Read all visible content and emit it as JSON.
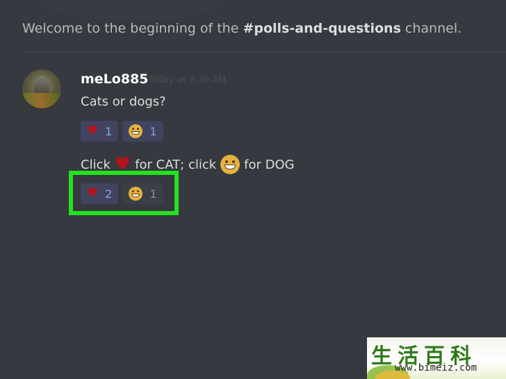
{
  "channel": {
    "welcome_prefix": "Welcome to the beginning of the ",
    "name": "#polls-and-questions",
    "welcome_suffix": " channel."
  },
  "message": {
    "username": "meLo885",
    "timestamp": "Today at 9:30 AM",
    "line1": "Cats or dogs?",
    "reactions1": [
      {
        "icon": "heart-icon",
        "count": "1"
      },
      {
        "icon": "grinning-face-icon",
        "count": "1"
      }
    ],
    "line2_part1": "Click",
    "line2_part2": "for CAT; click",
    "line2_part3": "for DOG",
    "reactions2": [
      {
        "icon": "heart-icon",
        "count": "2"
      },
      {
        "icon": "grinning-face-icon",
        "count": "1"
      }
    ]
  },
  "watermark": {
    "chars": "生活百科",
    "url": "www.bimeiz.com"
  },
  "colors": {
    "background": "#36393f",
    "highlight": "#22e31f",
    "heart": "#b5121b",
    "reaction_active_count": "#8ea1e1"
  }
}
